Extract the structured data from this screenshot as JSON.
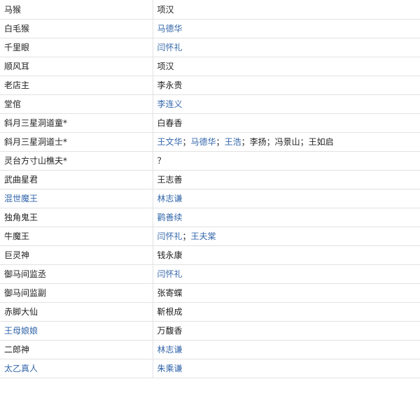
{
  "colors": {
    "link": "#3366aa",
    "text": "#222222",
    "border": "#e2e2e2"
  },
  "rows": [
    {
      "role": [
        {
          "t": "马猴",
          "link": false
        }
      ],
      "actor": [
        {
          "t": "项汉",
          "link": false
        }
      ]
    },
    {
      "role": [
        {
          "t": "白毛猴",
          "link": false
        }
      ],
      "actor": [
        {
          "t": "马德华",
          "link": true
        }
      ]
    },
    {
      "role": [
        {
          "t": "千里眼",
          "link": false
        }
      ],
      "actor": [
        {
          "t": "闫怀礼",
          "link": true
        }
      ]
    },
    {
      "role": [
        {
          "t": "顺风耳",
          "link": false
        }
      ],
      "actor": [
        {
          "t": "项汉",
          "link": false
        }
      ]
    },
    {
      "role": [
        {
          "t": "老店主",
          "link": false
        }
      ],
      "actor": [
        {
          "t": "李永贵",
          "link": false
        }
      ]
    },
    {
      "role": [
        {
          "t": "堂倌",
          "link": false
        }
      ],
      "actor": [
        {
          "t": "李连义",
          "link": true
        }
      ]
    },
    {
      "role": [
        {
          "t": "斜月三星洞道童*",
          "link": false
        }
      ],
      "actor": [
        {
          "t": "白春香",
          "link": false
        }
      ]
    },
    {
      "role": [
        {
          "t": "斜月三星洞道士*",
          "link": false
        }
      ],
      "actor": [
        {
          "t": "王文华",
          "link": true
        },
        {
          "t": "；",
          "link": false
        },
        {
          "t": "马德华",
          "link": true
        },
        {
          "t": "；",
          "link": false
        },
        {
          "t": "王浩",
          "link": true
        },
        {
          "t": "；李扬；冯景山；王如启",
          "link": false
        }
      ]
    },
    {
      "role": [
        {
          "t": "灵台方寸山樵夫*",
          "link": false
        }
      ],
      "actor": [
        {
          "t": "？",
          "link": false
        }
      ]
    },
    {
      "role": [
        {
          "t": "武曲星君",
          "link": false
        }
      ],
      "actor": [
        {
          "t": "王志善",
          "link": false
        }
      ]
    },
    {
      "role": [
        {
          "t": "混世魔王",
          "link": true
        }
      ],
      "actor": [
        {
          "t": "林志谦",
          "link": true
        }
      ]
    },
    {
      "role": [
        {
          "t": "独角鬼王",
          "link": false
        }
      ],
      "actor": [
        {
          "t": "鹳善续",
          "link": true
        }
      ]
    },
    {
      "role": [
        {
          "t": "牛魔王",
          "link": false
        }
      ],
      "actor": [
        {
          "t": "闫怀礼",
          "link": true
        },
        {
          "t": "；",
          "link": false
        },
        {
          "t": "王夫棠",
          "link": true
        }
      ]
    },
    {
      "role": [
        {
          "t": "巨灵神",
          "link": false
        }
      ],
      "actor": [
        {
          "t": "钱永康",
          "link": false
        }
      ]
    },
    {
      "role": [
        {
          "t": "御马间监丞",
          "link": false
        }
      ],
      "actor": [
        {
          "t": "闫怀礼",
          "link": true
        }
      ]
    },
    {
      "role": [
        {
          "t": "御马间监副",
          "link": false
        }
      ],
      "actor": [
        {
          "t": "张寄蝶",
          "link": false
        }
      ]
    },
    {
      "role": [
        {
          "t": "赤脚大仙",
          "link": false
        }
      ],
      "actor": [
        {
          "t": "靳根成",
          "link": false
        }
      ]
    },
    {
      "role": [
        {
          "t": "王母娘娘",
          "link": true
        }
      ],
      "actor": [
        {
          "t": "万馥香",
          "link": false
        }
      ]
    },
    {
      "role": [
        {
          "t": "二郎神",
          "link": false
        }
      ],
      "actor": [
        {
          "t": "林志谦",
          "link": true
        }
      ]
    },
    {
      "role": [
        {
          "t": "太乙真人",
          "link": true
        }
      ],
      "actor": [
        {
          "t": "朱乘谦",
          "link": true
        }
      ]
    }
  ]
}
